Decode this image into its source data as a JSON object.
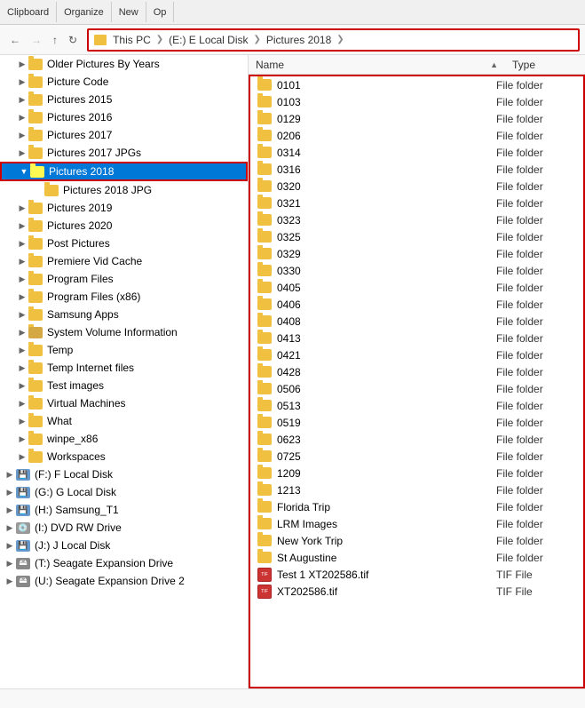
{
  "toolbar": {
    "sections": [
      "Clipboard",
      "Organize",
      "New",
      "Op"
    ]
  },
  "addressBar": {
    "crumbs": [
      {
        "label": "This PC"
      },
      {
        "label": "(E:) E Local Disk"
      },
      {
        "label": "Pictures 2018"
      }
    ]
  },
  "columns": {
    "name": "Name",
    "type": "Type"
  },
  "leftPanel": {
    "items": [
      {
        "id": "older-pictures",
        "label": "Older Pictures By Years",
        "indent": 1,
        "expanded": false,
        "type": "folder"
      },
      {
        "id": "picture-code",
        "label": "Picture Code",
        "indent": 1,
        "expanded": false,
        "type": "folder"
      },
      {
        "id": "pictures-2015",
        "label": "Pictures 2015",
        "indent": 1,
        "expanded": false,
        "type": "folder"
      },
      {
        "id": "pictures-2016",
        "label": "Pictures 2016",
        "indent": 1,
        "expanded": false,
        "type": "folder"
      },
      {
        "id": "pictures-2017",
        "label": "Pictures 2017",
        "indent": 1,
        "expanded": false,
        "type": "folder"
      },
      {
        "id": "pictures-2017-jpg",
        "label": "Pictures 2017 JPGs",
        "indent": 1,
        "expanded": false,
        "type": "folder"
      },
      {
        "id": "pictures-2018",
        "label": "Pictures 2018",
        "indent": 1,
        "expanded": true,
        "type": "folder",
        "selected": true
      },
      {
        "id": "pictures-2018-jpg",
        "label": "Pictures 2018 JPG",
        "indent": 2,
        "expanded": false,
        "type": "folder"
      },
      {
        "id": "pictures-2019",
        "label": "Pictures 2019",
        "indent": 1,
        "expanded": false,
        "type": "folder"
      },
      {
        "id": "pictures-2020",
        "label": "Pictures 2020",
        "indent": 1,
        "expanded": false,
        "type": "folder"
      },
      {
        "id": "post-pictures",
        "label": "Post Pictures",
        "indent": 1,
        "expanded": false,
        "type": "folder"
      },
      {
        "id": "premiere-vid",
        "label": "Premiere Vid Cache",
        "indent": 1,
        "expanded": false,
        "type": "folder"
      },
      {
        "id": "program-files",
        "label": "Program Files",
        "indent": 1,
        "expanded": false,
        "type": "folder"
      },
      {
        "id": "program-files-x86",
        "label": "Program Files (x86)",
        "indent": 1,
        "expanded": false,
        "type": "folder"
      },
      {
        "id": "samsung-apps",
        "label": "Samsung Apps",
        "indent": 1,
        "expanded": false,
        "type": "folder"
      },
      {
        "id": "system-volume",
        "label": "System Volume Information",
        "indent": 1,
        "expanded": false,
        "type": "folder",
        "special": true
      },
      {
        "id": "temp",
        "label": "Temp",
        "indent": 1,
        "expanded": false,
        "type": "folder"
      },
      {
        "id": "temp-internet",
        "label": "Temp Internet files",
        "indent": 1,
        "expanded": false,
        "type": "folder"
      },
      {
        "id": "test-images",
        "label": "Test images",
        "indent": 1,
        "expanded": false,
        "type": "folder"
      },
      {
        "id": "virtual-machines",
        "label": "Virtual Machines",
        "indent": 1,
        "expanded": false,
        "type": "folder"
      },
      {
        "id": "what",
        "label": "What",
        "indent": 1,
        "expanded": false,
        "type": "folder"
      },
      {
        "id": "winpe-x86",
        "label": "winpe_x86",
        "indent": 1,
        "expanded": false,
        "type": "folder"
      },
      {
        "id": "workspaces",
        "label": "Workspaces",
        "indent": 1,
        "expanded": false,
        "type": "folder"
      },
      {
        "id": "f-local",
        "label": "(F:) F Local Disk",
        "indent": 0,
        "expanded": false,
        "type": "drive-hd"
      },
      {
        "id": "g-local",
        "label": "(G:) G Local Disk",
        "indent": 0,
        "expanded": false,
        "type": "drive-hd"
      },
      {
        "id": "h-samsung",
        "label": "(H:) Samsung_T1",
        "indent": 0,
        "expanded": false,
        "type": "drive-hd"
      },
      {
        "id": "i-dvd",
        "label": "(I:) DVD RW Drive",
        "indent": 0,
        "expanded": false,
        "type": "drive-cd"
      },
      {
        "id": "j-local",
        "label": "(J:) J Local Disk",
        "indent": 0,
        "expanded": false,
        "type": "drive-hd"
      },
      {
        "id": "t-seagate",
        "label": "(T:) Seagate Expansion Drive",
        "indent": 0,
        "expanded": false,
        "type": "drive-usb"
      },
      {
        "id": "u-seagate2",
        "label": "(U:) Seagate Expansion Drive 2",
        "indent": 0,
        "expanded": false,
        "type": "drive-usb"
      }
    ]
  },
  "rightPanel": {
    "files": [
      {
        "name": "0101",
        "type": "File folder",
        "fileType": "folder"
      },
      {
        "name": "0103",
        "type": "File folder",
        "fileType": "folder"
      },
      {
        "name": "0129",
        "type": "File folder",
        "fileType": "folder"
      },
      {
        "name": "0206",
        "type": "File folder",
        "fileType": "folder"
      },
      {
        "name": "0314",
        "type": "File folder",
        "fileType": "folder"
      },
      {
        "name": "0316",
        "type": "File folder",
        "fileType": "folder"
      },
      {
        "name": "0320",
        "type": "File folder",
        "fileType": "folder"
      },
      {
        "name": "0321",
        "type": "File folder",
        "fileType": "folder"
      },
      {
        "name": "0323",
        "type": "File folder",
        "fileType": "folder"
      },
      {
        "name": "0325",
        "type": "File folder",
        "fileType": "folder"
      },
      {
        "name": "0329",
        "type": "File folder",
        "fileType": "folder"
      },
      {
        "name": "0330",
        "type": "File folder",
        "fileType": "folder"
      },
      {
        "name": "0405",
        "type": "File folder",
        "fileType": "folder"
      },
      {
        "name": "0406",
        "type": "File folder",
        "fileType": "folder"
      },
      {
        "name": "0408",
        "type": "File folder",
        "fileType": "folder"
      },
      {
        "name": "0413",
        "type": "File folder",
        "fileType": "folder"
      },
      {
        "name": "0421",
        "type": "File folder",
        "fileType": "folder"
      },
      {
        "name": "0428",
        "type": "File folder",
        "fileType": "folder"
      },
      {
        "name": "0506",
        "type": "File folder",
        "fileType": "folder"
      },
      {
        "name": "0513",
        "type": "File folder",
        "fileType": "folder"
      },
      {
        "name": "0519",
        "type": "File folder",
        "fileType": "folder"
      },
      {
        "name": "0623",
        "type": "File folder",
        "fileType": "folder"
      },
      {
        "name": "0725",
        "type": "File folder",
        "fileType": "folder"
      },
      {
        "name": "1209",
        "type": "File folder",
        "fileType": "folder"
      },
      {
        "name": "1213",
        "type": "File folder",
        "fileType": "folder"
      },
      {
        "name": "Florida Trip",
        "type": "File folder",
        "fileType": "folder"
      },
      {
        "name": "LRM Images",
        "type": "File folder",
        "fileType": "folder"
      },
      {
        "name": "New York Trip",
        "type": "File folder",
        "fileType": "folder"
      },
      {
        "name": "St Augustine",
        "type": "File folder",
        "fileType": "folder"
      },
      {
        "name": "Test 1 XT202586.tif",
        "type": "TIF File",
        "fileType": "tif"
      },
      {
        "name": "XT202586.tif",
        "type": "TIF File",
        "fileType": "tif"
      }
    ]
  },
  "statusBar": {
    "text": ""
  }
}
